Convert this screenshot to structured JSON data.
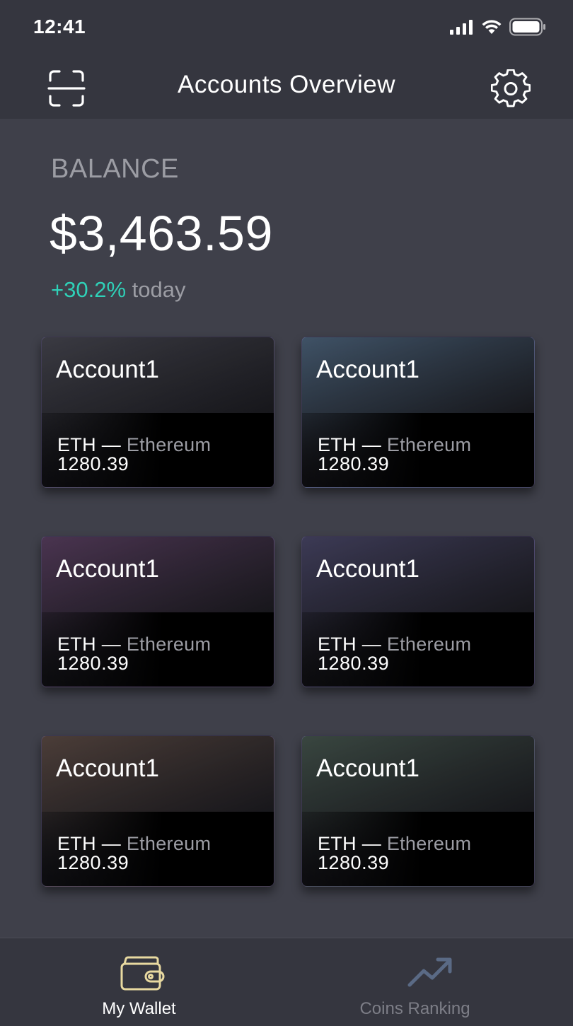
{
  "status_bar": {
    "time": "12:41"
  },
  "nav": {
    "title": "Accounts Overview"
  },
  "balance": {
    "label": "BALANCE",
    "amount": "$3,463.59",
    "change_pct": "+30.2%",
    "change_label": " today"
  },
  "cards": [
    {
      "title": "Account1",
      "symbol": "ETH",
      "separator": " — ",
      "coin": "Ethereum",
      "value": "1280.39",
      "tint": "#3a3a42"
    },
    {
      "title": "Account1",
      "symbol": "ETH",
      "separator": " — ",
      "coin": "Ethereum",
      "value": "1280.39",
      "tint": "#3f5266"
    },
    {
      "title": "Account1",
      "symbol": "ETH",
      "separator": " — ",
      "coin": "Ethereum",
      "value": "1280.39",
      "tint": "#4a3450"
    },
    {
      "title": "Account1",
      "symbol": "ETH",
      "separator": " — ",
      "coin": "Ethereum",
      "value": "1280.39",
      "tint": "#3c3a55"
    },
    {
      "title": "Account1",
      "symbol": "ETH",
      "separator": " — ",
      "coin": "Ethereum",
      "value": "1280.39",
      "tint": "#4b3d38"
    },
    {
      "title": "Account1",
      "symbol": "ETH",
      "separator": " — ",
      "coin": "Ethereum",
      "value": "1280.39",
      "tint": "#394640"
    }
  ],
  "tabs": [
    {
      "label": "My Wallet",
      "icon": "wallet-icon",
      "active": true
    },
    {
      "label": "Coins Ranking",
      "icon": "trending-up-icon",
      "active": false
    }
  ],
  "colors": {
    "background": "#3f404a",
    "bar": "#35363f",
    "positive": "#2fd1b8",
    "muted": "#9c9da4",
    "wallet_icon": "#e8d9a0",
    "ranking_icon": "#5a6a85"
  }
}
